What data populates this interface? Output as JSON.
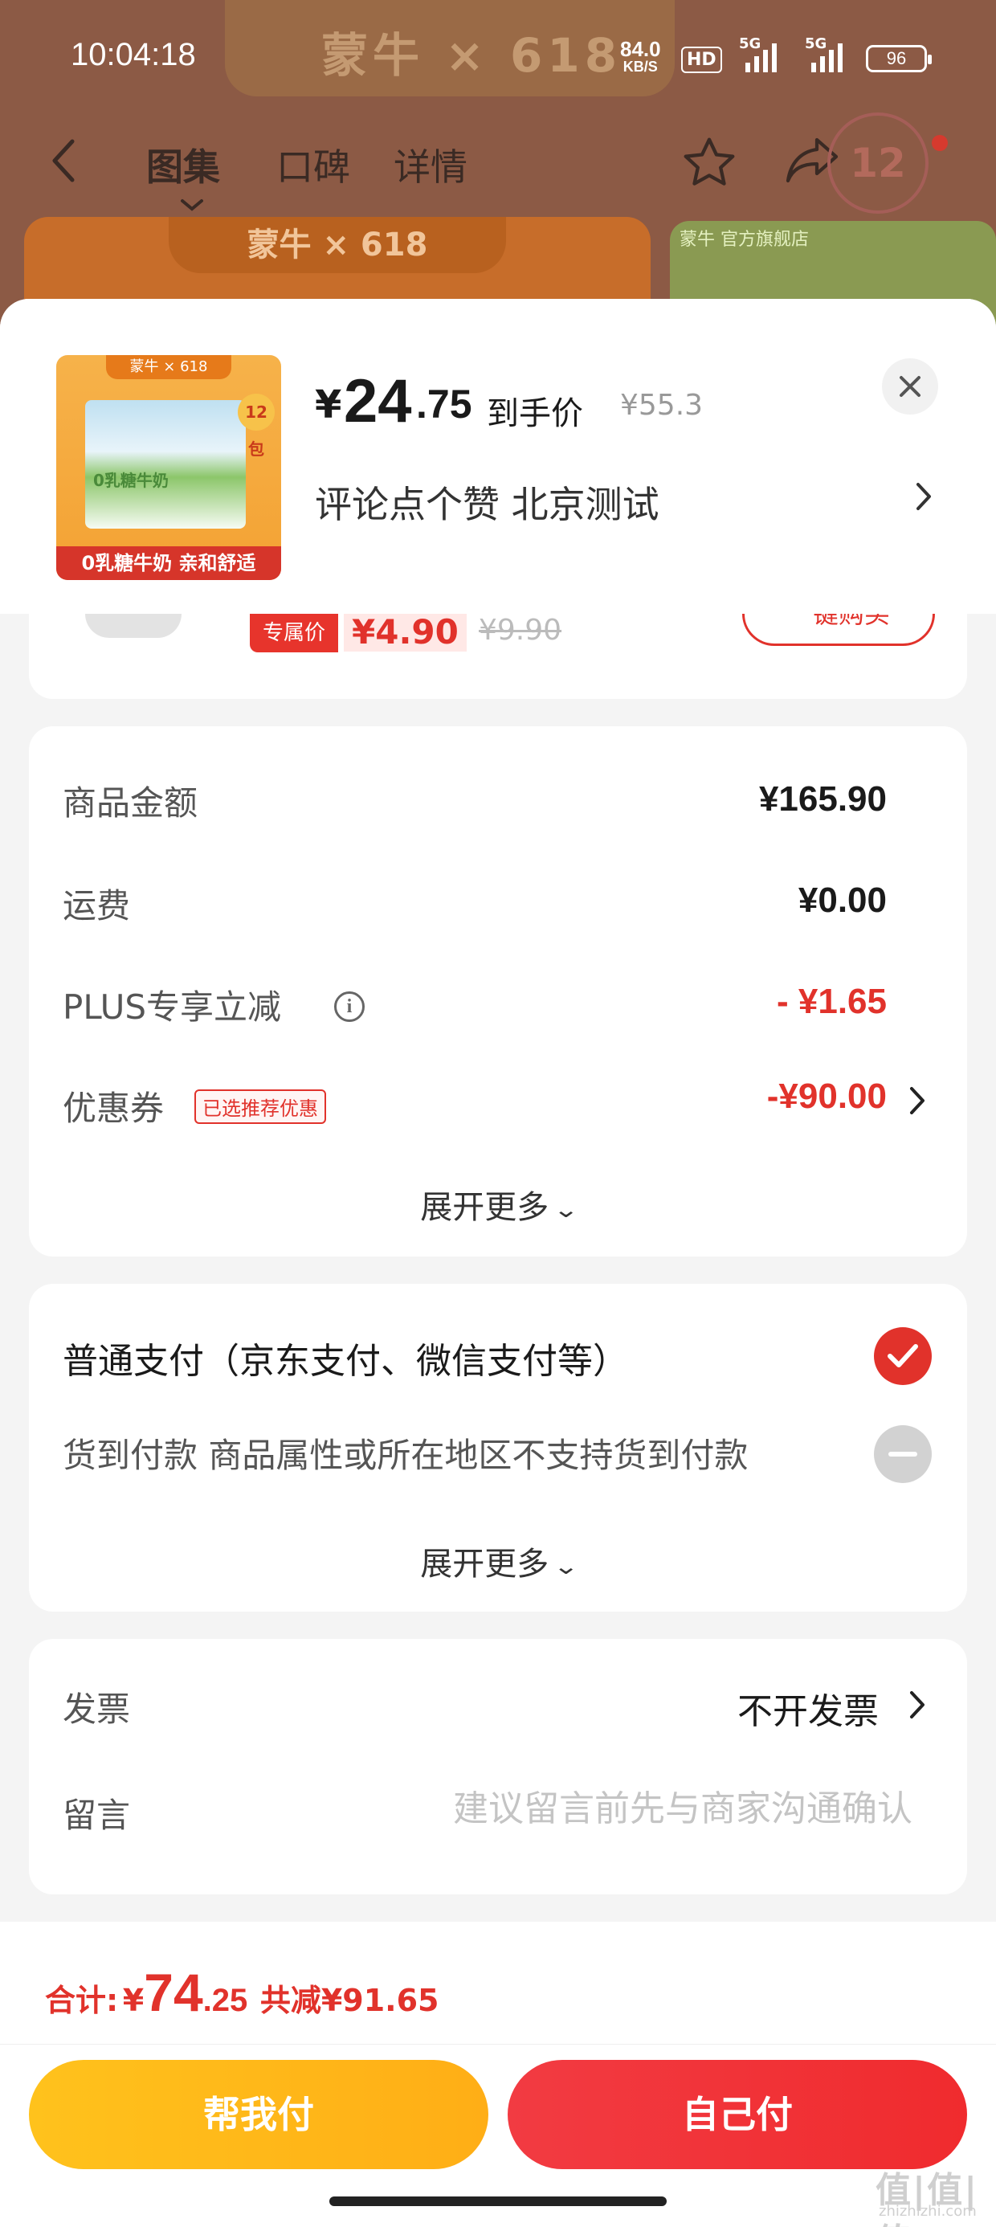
{
  "status_bar": {
    "time": "10:04:18",
    "net_speed": "84.0",
    "net_speed_unit": "KB/S",
    "hd_label": "HD",
    "signal1_label": "5G",
    "signal2_label": "5G",
    "battery": "96"
  },
  "background_page": {
    "banner_text": "蒙牛 × 618",
    "tabs": [
      "图集",
      "口碑",
      "详情"
    ],
    "badge": "12包",
    "card_title": "蒙牛 × 618",
    "card2_tag": "蒙牛 官方旗舰店"
  },
  "product": {
    "thumb_brand": "蒙牛 × 618",
    "thumb_name": "0乳糖牛奶",
    "thumb_count": "12包",
    "thumb_caption": "0乳糖牛奶 亲和舒适",
    "price_symbol": "¥",
    "price_int": "24",
    "price_dec": ".75",
    "price_label": "到手价",
    "original_price": "¥55.3",
    "spec": "评论点个赞  北京测试"
  },
  "promo": {
    "tag": "专属价",
    "price": "¥4.90",
    "original": "¥9.90",
    "button": "一键购买"
  },
  "amounts": {
    "rows": [
      {
        "label": "商品金额",
        "value": "¥165.90"
      },
      {
        "label": "运费",
        "value": "¥0.00"
      },
      {
        "label": "PLUS专享立减",
        "value": "- ¥1.65"
      },
      {
        "label": "优惠券",
        "value": "-¥90.00"
      }
    ],
    "info_icon": "i",
    "coupon_badge": "已选推荐优惠",
    "expand": "展开更多"
  },
  "payment": {
    "normal": "普通支付（京东支付、微信支付等）",
    "cod": "货到付款 商品属性或所在地区不支持货到付款",
    "expand": "展开更多"
  },
  "invoice": {
    "label": "发票",
    "value": "不开发票"
  },
  "message": {
    "label": "留言",
    "placeholder": "建议留言前先与商家沟通确认"
  },
  "total": {
    "label": "合计:",
    "symbol": "¥",
    "int": "74",
    "dec": ".25",
    "saving": "共减¥91.65"
  },
  "actions": {
    "help_pay": "帮我付",
    "self_pay": "自己付"
  },
  "watermark": "值|值|值",
  "watermark_sub": "zhizhizhi.com",
  "colors": {
    "accent_red": "#e1322b",
    "help_pay_yellow": "#ffb619",
    "self_pay_red": "#f0302f"
  }
}
